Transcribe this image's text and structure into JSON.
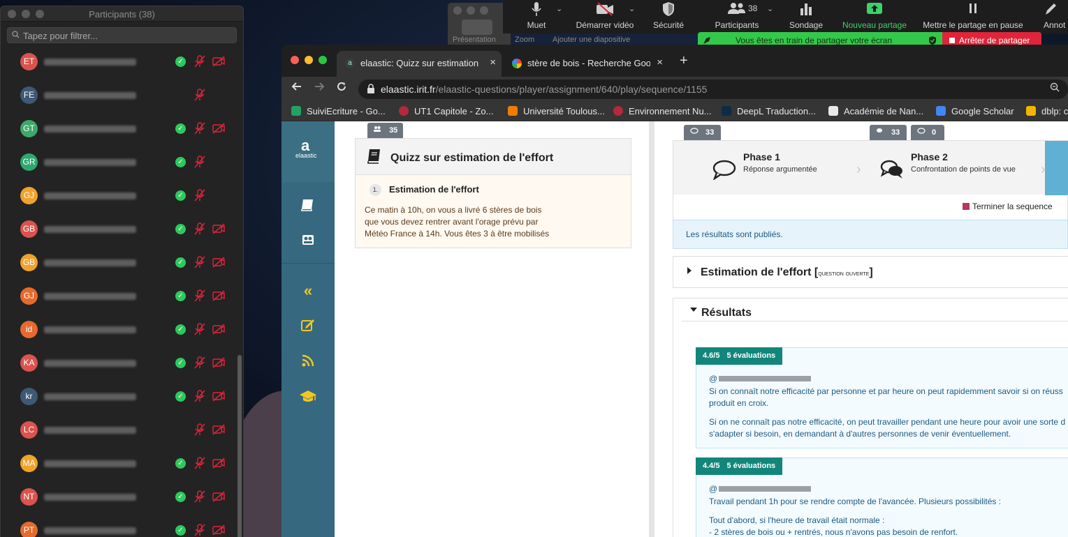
{
  "participants_window": {
    "title": "Participants (38)",
    "search_placeholder": "Tapez pour filtrer...",
    "rows": [
      {
        "initials": "ET",
        "color": "#d9534f",
        "check": true,
        "cam": true
      },
      {
        "initials": "FE",
        "color": "#3f5873",
        "check": false,
        "cam": false
      },
      {
        "initials": "GT",
        "color": "#3ea86b",
        "check": true,
        "cam": true
      },
      {
        "initials": "GR",
        "color": "#2fa870",
        "check": true,
        "cam": false
      },
      {
        "initials": "GJ",
        "color": "#f0a22c",
        "check": true,
        "cam": false
      },
      {
        "initials": "GB",
        "color": "#d9534f",
        "check": true,
        "cam": true
      },
      {
        "initials": "GB",
        "color": "#f0a22c",
        "check": true,
        "cam": true
      },
      {
        "initials": "GJ",
        "color": "#e66a2e",
        "check": true,
        "cam": true
      },
      {
        "initials": "id",
        "color": "#e66a2e",
        "check": true,
        "cam": true
      },
      {
        "initials": "KA",
        "color": "#d9534f",
        "check": true,
        "cam": true
      },
      {
        "initials": "kr",
        "color": "#3f5873",
        "check": true,
        "cam": true
      },
      {
        "initials": "LC",
        "color": "#d9534f",
        "check": false,
        "cam": true
      },
      {
        "initials": "MA",
        "color": "#f0a22c",
        "check": true,
        "cam": true
      },
      {
        "initials": "NT",
        "color": "#d9534f",
        "check": true,
        "cam": true
      },
      {
        "initials": "PT",
        "color": "#e66a2e",
        "check": true,
        "cam": true
      }
    ]
  },
  "zoom_toolbar": {
    "items": [
      {
        "label": "Muet",
        "icon": "mic-icon"
      },
      {
        "label": "Démarrer vidéo",
        "icon": "video-off-icon"
      },
      {
        "label": "Sécurité",
        "icon": "shield-icon"
      },
      {
        "label": "Participants",
        "icon": "participants-icon",
        "count": "38"
      },
      {
        "label": "Sondage",
        "icon": "poll-icon"
      },
      {
        "label": "Nouveau partage",
        "icon": "share-up-icon"
      },
      {
        "label": "Mettre le partage en pause",
        "icon": "pause-icon"
      },
      {
        "label": "Annot",
        "icon": "pen-icon"
      }
    ],
    "sub_labels": [
      "Présentation",
      "Zoom",
      "Ajouter une diapositive"
    ],
    "sharing_text": "Vous êtes en train de partager votre écran",
    "stop_label": "Arrêter de partager"
  },
  "browser": {
    "tabs": [
      {
        "title": "elaastic: Quizz sur estimation de l'effort",
        "active": true
      },
      {
        "title": "stère de bois - Recherche Google",
        "active": false
      }
    ],
    "url_host": "elaastic.irit.fr",
    "url_path": "/elaastic-questions/player/assignment/640/play/sequence/1155",
    "bookmarks": [
      "SuiviEcriture - Go...",
      "UT1 Capitole - Zo...",
      "Université Toulous...",
      "Environnement Nu...",
      "DeepL Traduction...",
      "Académie de Nan...",
      "Google Scholar",
      "dblp: c"
    ]
  },
  "app": {
    "logo_text": "elaastic",
    "participants_count": "35",
    "quiz_title": "Quizz sur estimation de l'effort",
    "question_number": "1.",
    "question_title": "Estimation de l'effort",
    "question_text": [
      "Ce matin à 10h, on vous a livré 6 stères de bois",
      "que vous devez rentrer avant l'orage prévu par",
      "Météo France à 14h. Vous êtes 3 à être mobilisés"
    ],
    "phases": [
      {
        "count": "33",
        "title": "Phase 1",
        "subtitle": "Réponse argumentée"
      },
      {
        "count_a": "33",
        "count_b": "0",
        "title": "Phase 2",
        "subtitle": "Confrontation de points de vue"
      }
    ],
    "end_sequence_label": "Terminer la sequence",
    "published_text": "Les résultats sont publiés.",
    "accordion_question": "Estimation de l'effort",
    "accordion_question_tag": "question ouverte",
    "results_title": "Résultats",
    "results": [
      {
        "score": "4.6/5",
        "evaluations": "5 évaluations",
        "lines": [
          "Si on connaît notre efficacité par personne et par heure on peut rapidemment savoir si on réuss",
          "produit en croix.",
          "Si on ne connaît pas notre efficacité, on peut travailler pendant une heure pour avoir une sorte d",
          "s'adapter si besoin, en demandant à d'autres personnes de venir éventuellement."
        ]
      },
      {
        "score": "4.4/5",
        "evaluations": "5 évaluations",
        "lines": [
          "Travail pendant 1h pour se rendre compte de l'avancée. Plusieurs possibilités :",
          "Tout d'abord, si l'heure de travail était normale :",
          "- 2 stères de bois ou + rentrés, nous n'avons pas besoin de renfort."
        ]
      }
    ]
  }
}
